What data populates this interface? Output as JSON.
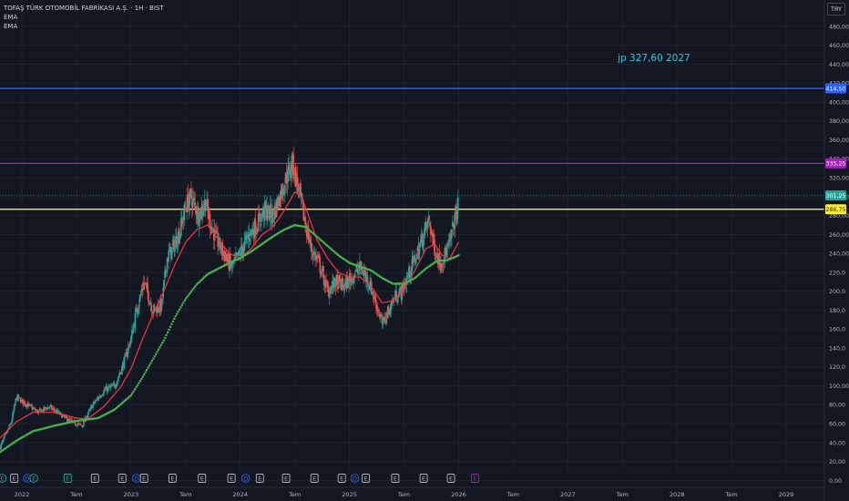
{
  "header": {
    "title": "TOFAŞ TÜRK OTOMOBİL FABRİKASI A.Ş. · 1H · BIST",
    "indicators": [
      "EMA",
      "EMA"
    ],
    "currency": "TRY"
  },
  "annotation": {
    "text": "jp 327,60 2027"
  },
  "colors": {
    "background": "#131722",
    "up": "#26a69a",
    "down": "#ef5350",
    "ema_fast": "#f23645",
    "ema_slow": "#4caf50",
    "axis_text": "#b2b5be",
    "grid": "#1e222d"
  },
  "chart_data": {
    "type": "candlestick",
    "ylim": [
      0,
      500
    ],
    "y_ticks": [
      "0,00",
      "20,00",
      "40,00",
      "60,00",
      "80,00",
      "100,00",
      "120,0",
      "140,0",
      "160,0",
      "180,0",
      "200,0",
      "220,0",
      "240,00",
      "260,00",
      "280,00",
      "300,00",
      "320,00",
      "340,00",
      "360,00",
      "380,00",
      "400,00",
      "420,00",
      "440,00",
      "460,00",
      "480,00"
    ],
    "y_tick_values": [
      0,
      20,
      40,
      60,
      80,
      100,
      120,
      140,
      160,
      180,
      200,
      220,
      240,
      260,
      280,
      300,
      320,
      340,
      360,
      380,
      400,
      420,
      440,
      460,
      480
    ],
    "x_ticks": [
      {
        "label": "2022",
        "t": 2022.0
      },
      {
        "label": "Tem",
        "t": 2022.5
      },
      {
        "label": "2023",
        "t": 2023.0
      },
      {
        "label": "Tem",
        "t": 2023.5
      },
      {
        "label": "2024",
        "t": 2024.0
      },
      {
        "label": "Tem",
        "t": 2024.5
      },
      {
        "label": "2025",
        "t": 2025.0
      },
      {
        "label": "Tem",
        "t": 2025.5
      },
      {
        "label": "2026",
        "t": 2026.0
      },
      {
        "label": "Tem",
        "t": 2026.5
      },
      {
        "label": "2027",
        "t": 2027.0
      },
      {
        "label": "Tem",
        "t": 2027.5
      },
      {
        "label": "2028",
        "t": 2028.0
      },
      {
        "label": "Tem",
        "t": 2028.5
      },
      {
        "label": "2029",
        "t": 2029.0
      }
    ],
    "x_range": [
      2021.8,
      2029.35
    ],
    "close_path": [
      [
        2021.8,
        35
      ],
      [
        2021.9,
        60
      ],
      [
        2021.95,
        88
      ],
      [
        2022.05,
        80
      ],
      [
        2022.15,
        72
      ],
      [
        2022.25,
        78
      ],
      [
        2022.35,
        70
      ],
      [
        2022.45,
        62
      ],
      [
        2022.55,
        58
      ],
      [
        2022.65,
        80
      ],
      [
        2022.75,
        95
      ],
      [
        2022.85,
        100
      ],
      [
        2022.92,
        120
      ],
      [
        2023.0,
        150
      ],
      [
        2023.05,
        180
      ],
      [
        2023.12,
        210
      ],
      [
        2023.2,
        180
      ],
      [
        2023.28,
        185
      ],
      [
        2023.33,
        235
      ],
      [
        2023.38,
        245
      ],
      [
        2023.45,
        265
      ],
      [
        2023.5,
        290
      ],
      [
        2023.55,
        300
      ],
      [
        2023.62,
        280
      ],
      [
        2023.68,
        295
      ],
      [
        2023.72,
        275
      ],
      [
        2023.78,
        255
      ],
      [
        2023.85,
        240
      ],
      [
        2023.92,
        225
      ],
      [
        2024.0,
        240
      ],
      [
        2024.08,
        260
      ],
      [
        2024.15,
        270
      ],
      [
        2024.22,
        285
      ],
      [
        2024.3,
        280
      ],
      [
        2024.36,
        300
      ],
      [
        2024.42,
        320
      ],
      [
        2024.48,
        335
      ],
      [
        2024.53,
        310
      ],
      [
        2024.58,
        280
      ],
      [
        2024.65,
        245
      ],
      [
        2024.72,
        230
      ],
      [
        2024.8,
        200
      ],
      [
        2024.88,
        210
      ],
      [
        2024.95,
        205
      ],
      [
        2025.02,
        215
      ],
      [
        2025.1,
        225
      ],
      [
        2025.18,
        210
      ],
      [
        2025.25,
        185
      ],
      [
        2025.3,
        165
      ],
      [
        2025.36,
        180
      ],
      [
        2025.42,
        195
      ],
      [
        2025.48,
        200
      ],
      [
        2025.55,
        220
      ],
      [
        2025.62,
        240
      ],
      [
        2025.68,
        260
      ],
      [
        2025.73,
        275
      ],
      [
        2025.78,
        245
      ],
      [
        2025.83,
        230
      ],
      [
        2025.88,
        240
      ],
      [
        2025.92,
        250
      ],
      [
        2025.96,
        275
      ],
      [
        2026.0,
        292
      ]
    ],
    "ema_fast_path": [
      [
        2021.8,
        45
      ],
      [
        2021.95,
        62
      ],
      [
        2022.1,
        72
      ],
      [
        2022.3,
        72
      ],
      [
        2022.5,
        66
      ],
      [
        2022.6,
        65
      ],
      [
        2022.75,
        78
      ],
      [
        2022.9,
        98
      ],
      [
        2023.0,
        118
      ],
      [
        2023.1,
        148
      ],
      [
        2023.2,
        175
      ],
      [
        2023.3,
        200
      ],
      [
        2023.4,
        228
      ],
      [
        2023.5,
        252
      ],
      [
        2023.6,
        265
      ],
      [
        2023.7,
        270
      ],
      [
        2023.8,
        255
      ],
      [
        2023.9,
        240
      ],
      [
        2024.0,
        235
      ],
      [
        2024.1,
        245
      ],
      [
        2024.2,
        260
      ],
      [
        2024.3,
        268
      ],
      [
        2024.4,
        285
      ],
      [
        2024.5,
        305
      ],
      [
        2024.56,
        300
      ],
      [
        2024.62,
        282
      ],
      [
        2024.7,
        255
      ],
      [
        2024.8,
        235
      ],
      [
        2024.9,
        220
      ],
      [
        2025.0,
        215
      ],
      [
        2025.1,
        215
      ],
      [
        2025.2,
        205
      ],
      [
        2025.3,
        188
      ],
      [
        2025.4,
        190
      ],
      [
        2025.5,
        203
      ],
      [
        2025.6,
        222
      ],
      [
        2025.7,
        245
      ],
      [
        2025.78,
        250
      ],
      [
        2025.85,
        238
      ],
      [
        2025.92,
        235
      ],
      [
        2026.0,
        252
      ]
    ],
    "ema_slow_path": [
      [
        2021.8,
        30
      ],
      [
        2021.95,
        42
      ],
      [
        2022.1,
        52
      ],
      [
        2022.3,
        58
      ],
      [
        2022.5,
        63
      ],
      [
        2022.7,
        66
      ],
      [
        2022.85,
        75
      ],
      [
        2023.0,
        90
      ],
      [
        2023.1,
        108
      ],
      [
        2023.2,
        128
      ],
      [
        2023.3,
        148
      ],
      [
        2023.4,
        172
      ],
      [
        2023.5,
        192
      ],
      [
        2023.6,
        207
      ],
      [
        2023.7,
        218
      ],
      [
        2023.8,
        224
      ],
      [
        2023.9,
        230
      ],
      [
        2024.0,
        235
      ],
      [
        2024.1,
        242
      ],
      [
        2024.2,
        250
      ],
      [
        2024.3,
        258
      ],
      [
        2024.4,
        265
      ],
      [
        2024.5,
        270
      ],
      [
        2024.6,
        268
      ],
      [
        2024.7,
        258
      ],
      [
        2024.8,
        248
      ],
      [
        2024.9,
        238
      ],
      [
        2025.0,
        230
      ],
      [
        2025.1,
        226
      ],
      [
        2025.2,
        222
      ],
      [
        2025.3,
        214
      ],
      [
        2025.4,
        208
      ],
      [
        2025.5,
        208
      ],
      [
        2025.6,
        214
      ],
      [
        2025.7,
        224
      ],
      [
        2025.8,
        232
      ],
      [
        2025.9,
        233
      ],
      [
        2026.0,
        238
      ]
    ],
    "horizontal_lines": [
      {
        "label": "414,50",
        "value": 414.5,
        "color": "#2962ff",
        "text_color": "#ffffff"
      },
      {
        "label": "335,25",
        "value": 335.25,
        "color": "#9c27b0",
        "text_color": "#ffffff"
      },
      {
        "label": "301,25",
        "value": 301.25,
        "color": "#26a69a",
        "text_color": "#ffffff",
        "dotted": true
      },
      {
        "label": "286,75",
        "value": 286.75,
        "color": "#ffeb3b",
        "text_color": "#131722"
      }
    ],
    "events": [
      {
        "t": 2021.82,
        "label": "E",
        "color": "#26a69a",
        "round": true
      },
      {
        "t": 2021.93,
        "label": "E",
        "color": "#b2b5be"
      },
      {
        "t": 2022.05,
        "label": "D",
        "color": "#2962ff",
        "round": true
      },
      {
        "t": 2022.11,
        "label": "E",
        "color": "#26a69a",
        "round": true
      },
      {
        "t": 2022.42,
        "label": "E",
        "color": "#26a69a"
      },
      {
        "t": 2022.67,
        "label": "E",
        "color": "#b2b5be"
      },
      {
        "t": 2022.92,
        "label": "E",
        "color": "#b2b5be"
      },
      {
        "t": 2023.05,
        "label": "D",
        "color": "#2962ff",
        "round": true
      },
      {
        "t": 2023.12,
        "label": "E",
        "color": "#b2b5be"
      },
      {
        "t": 2023.38,
        "label": "E",
        "color": "#b2b5be"
      },
      {
        "t": 2023.65,
        "label": "E",
        "color": "#b2b5be"
      },
      {
        "t": 2023.92,
        "label": "E",
        "color": "#b2b5be"
      },
      {
        "t": 2024.05,
        "label": "D",
        "color": "#2962ff",
        "round": true
      },
      {
        "t": 2024.18,
        "label": "E",
        "color": "#b2b5be"
      },
      {
        "t": 2024.42,
        "label": "E",
        "color": "#b2b5be"
      },
      {
        "t": 2024.68,
        "label": "E",
        "color": "#b2b5be"
      },
      {
        "t": 2024.93,
        "label": "E",
        "color": "#b2b5be"
      },
      {
        "t": 2025.05,
        "label": "D",
        "color": "#2962ff",
        "round": true
      },
      {
        "t": 2025.15,
        "label": "E",
        "color": "#b2b5be"
      },
      {
        "t": 2025.42,
        "label": "E",
        "color": "#b2b5be"
      },
      {
        "t": 2025.68,
        "label": "E",
        "color": "#b2b5be"
      },
      {
        "t": 2025.93,
        "label": "E",
        "color": "#b2b5be"
      },
      {
        "t": 2026.15,
        "label": "E",
        "color": "#9c27b0"
      }
    ]
  }
}
